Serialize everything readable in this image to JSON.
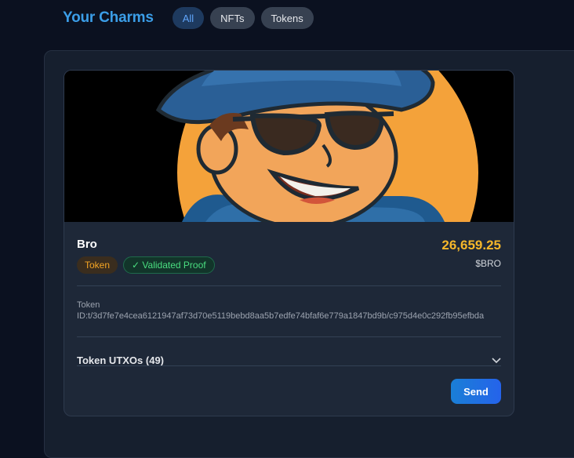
{
  "header": {
    "title": "Your Charms",
    "filters": [
      {
        "label": "All",
        "active": true
      },
      {
        "label": "NFTs",
        "active": false
      },
      {
        "label": "Tokens",
        "active": false
      }
    ]
  },
  "card": {
    "image_icon": "cartoon-avatar-sunglasses-hat",
    "name": "Bro",
    "badges": {
      "type": "Token",
      "proof": "✓ Validated Proof"
    },
    "amount": "26,659.25",
    "ticker": "$BRO",
    "token_label": "Token",
    "token_id": "ID:t/3d7fe7e4cea6121947af73d70e5119bebd8aa5b7edfe74bfaf6e779a1847bd9b/c975d4e0c292fb95efbda",
    "utxos_label": "Token UTXOs (49)",
    "send_label": "Send"
  },
  "colors": {
    "accent": "#3b9ee8",
    "amount": "#f5b72a",
    "token_badge": "#f5a524",
    "validated": "#4ade80"
  }
}
